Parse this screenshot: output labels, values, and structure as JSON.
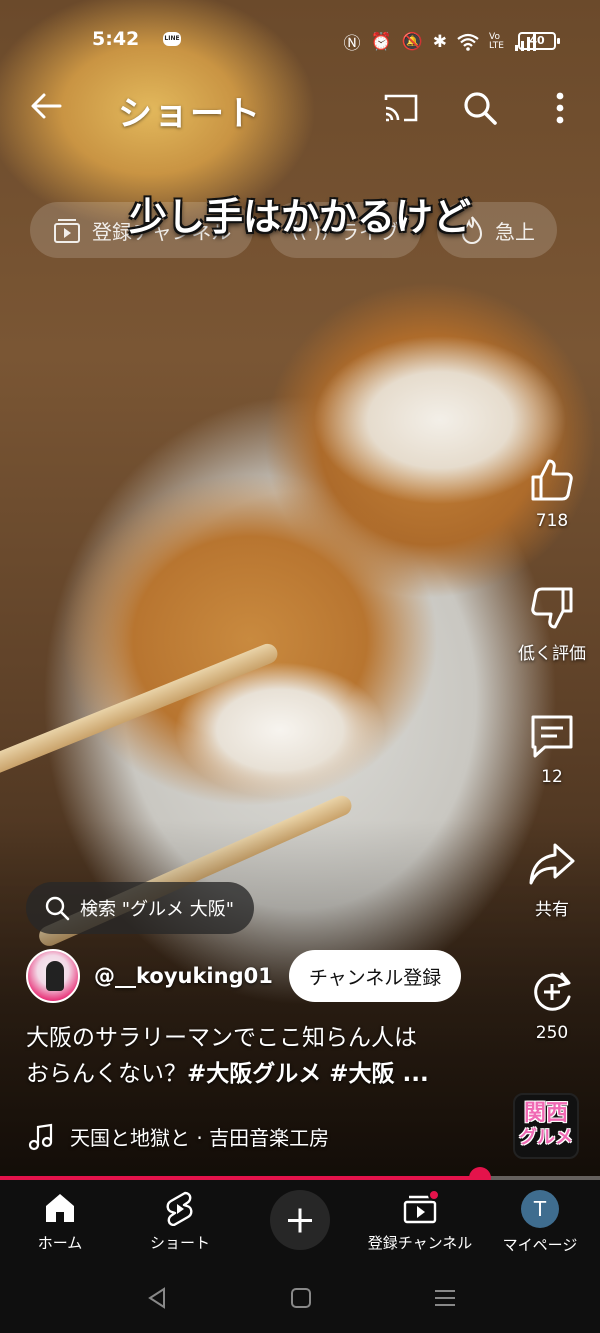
{
  "status_bar": {
    "time": "5:42",
    "line_label": "LINE",
    "battery": "40",
    "icons": [
      "nfc-icon",
      "alarm-icon",
      "mute-icon",
      "bluetooth-icon",
      "wifi-icon",
      "volte-icon",
      "signal-icon"
    ]
  },
  "top_bar": {
    "title": "ショート"
  },
  "chips": [
    {
      "label": "登録チャンネル",
      "icon": "subscriptions-icon"
    },
    {
      "label": "ライブ",
      "icon": "live-icon"
    },
    {
      "label": "急上",
      "icon": "trending-icon"
    }
  ],
  "video": {
    "caption": "少し手はかかるけど"
  },
  "actions": {
    "like_count": "718",
    "dislike_label": "低く評価",
    "comment_count": "12",
    "share_label": "共有",
    "remix_count": "250"
  },
  "search_suggestion": "検索 \"グルメ 大阪\"",
  "channel": {
    "name": "@__koyuking01",
    "subscribe_label": "チャンネル登録"
  },
  "description": {
    "line1": "大阪のサラリーマンでここ知らん人は",
    "line2_plain": "おらんくない？",
    "line2_tags": "#大阪グルメ #大阪 ..."
  },
  "music": {
    "title": "天国と地獄と · 吉田音楽工房"
  },
  "sound_thumb": {
    "line1": "関西",
    "line2": "グルメ"
  },
  "progress": {
    "fraction": 0.8
  },
  "bottom_nav": {
    "home": "ホーム",
    "shorts": "ショート",
    "subscriptions": "登録チャンネル",
    "you": "マイページ",
    "avatar_letter": "T"
  },
  "colors": {
    "accent": "#e4134b",
    "nav_bg": "#0f0f0f"
  }
}
